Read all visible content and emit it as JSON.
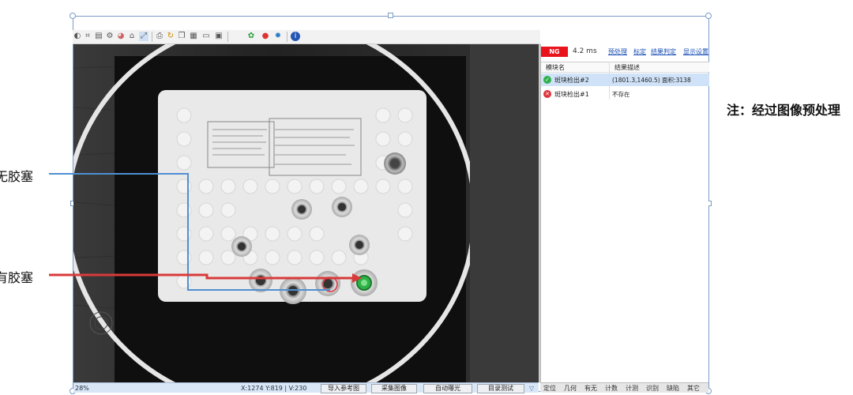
{
  "labels": {
    "no_stopper": "无胶塞",
    "has_stopper": "有胶塞",
    "note": "注：经过图像预处理"
  },
  "result_panel": {
    "status_badge": "NG",
    "time": "4.2 ms",
    "links": [
      "预处理",
      "标定",
      "结果判定",
      "显示设置"
    ],
    "columns": [
      "模块名",
      "结果描述"
    ],
    "rows": [
      {
        "name": "斑块检出#2",
        "status": "pass",
        "desc": "(1801.3,1460.5) 面积:3138"
      },
      {
        "name": "斑块检出#1",
        "status": "fail",
        "desc": "不存在"
      }
    ]
  },
  "status_bar": {
    "zoom": "28%",
    "coords": "X:1274  Y:819  |  V:230",
    "buttons": [
      "导入参考图",
      "采集图像",
      "自动曝光",
      "目录测试"
    ]
  },
  "tabs": [
    "定位",
    "几何",
    "有无",
    "计数",
    "计测",
    "识别",
    "缺陷",
    "其它"
  ],
  "colors": {
    "ng_red": "#e8131b",
    "pass_green": "#2fb14a",
    "fail_red": "#e0333b",
    "arrow_red": "#d93a3a",
    "line_blue": "#4f8fd1",
    "link_blue": "#1b4fb5"
  },
  "icons": {
    "toolbar": [
      "select-icon",
      "crop-icon",
      "doc-icon",
      "gear-icon",
      "chart-icon",
      "mouse-icon",
      "fit-icon",
      "print-icon",
      "refresh-icon",
      "copy-icon",
      "table-icon",
      "folder-icon",
      "export-icon",
      "aperture-icon",
      "location-icon",
      "settings-icon",
      "info-icon"
    ]
  }
}
